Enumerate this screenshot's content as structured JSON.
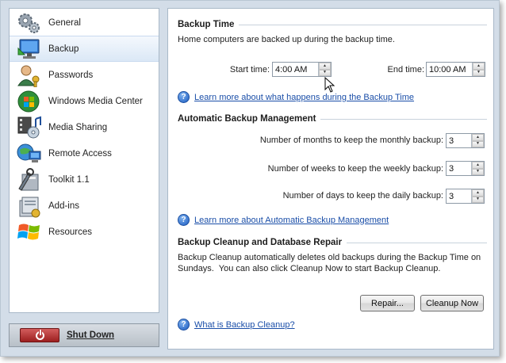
{
  "sidebar": {
    "items": [
      {
        "label": "General",
        "icon": "gears-icon"
      },
      {
        "label": "Backup",
        "icon": "backup-computer-icon"
      },
      {
        "label": "Passwords",
        "icon": "user-key-icon"
      },
      {
        "label": "Windows Media Center",
        "icon": "media-center-icon"
      },
      {
        "label": "Media Sharing",
        "icon": "media-sharing-icon"
      },
      {
        "label": "Remote Access",
        "icon": "remote-access-icon"
      },
      {
        "label": "Toolkit 1.1",
        "icon": "toolkit-icon"
      },
      {
        "label": "Add-ins",
        "icon": "addins-icon"
      },
      {
        "label": "Resources",
        "icon": "windows-flag-icon"
      }
    ],
    "selected": "Backup"
  },
  "shutdown": {
    "label": "Shut Down"
  },
  "backup_time": {
    "heading": "Backup Time",
    "description": "Home computers are backed up during the backup time.",
    "start_label": "Start time:",
    "start_value": "4:00 AM",
    "end_label": "End time:",
    "end_value": "10:00 AM",
    "help_link": "Learn more about what happens during the Backup Time"
  },
  "management": {
    "heading": "Automatic Backup Management",
    "monthly_label": "Number of months to keep the monthly backup:",
    "monthly_value": "3",
    "weekly_label": "Number of weeks to keep the weekly backup:",
    "weekly_value": "3",
    "daily_label": "Number of days to keep the daily backup:",
    "daily_value": "3",
    "help_link": "Learn more about Automatic Backup Management"
  },
  "cleanup": {
    "heading": "Backup Cleanup and Database Repair",
    "description_line1": "Backup Cleanup automatically deletes old backups during the Backup Time on",
    "description_line2": "Sundays.  You can also click Cleanup Now to start Backup Cleanup.",
    "repair_label": "Repair...",
    "cleanup_label": "Cleanup Now",
    "help_link": "What is Backup Cleanup?"
  },
  "colors": {
    "window_bg": "#d3dde8",
    "link": "#1a4ea8",
    "selected_bg": "#dbe8f6",
    "shutdown_red": "#b02a2a"
  }
}
